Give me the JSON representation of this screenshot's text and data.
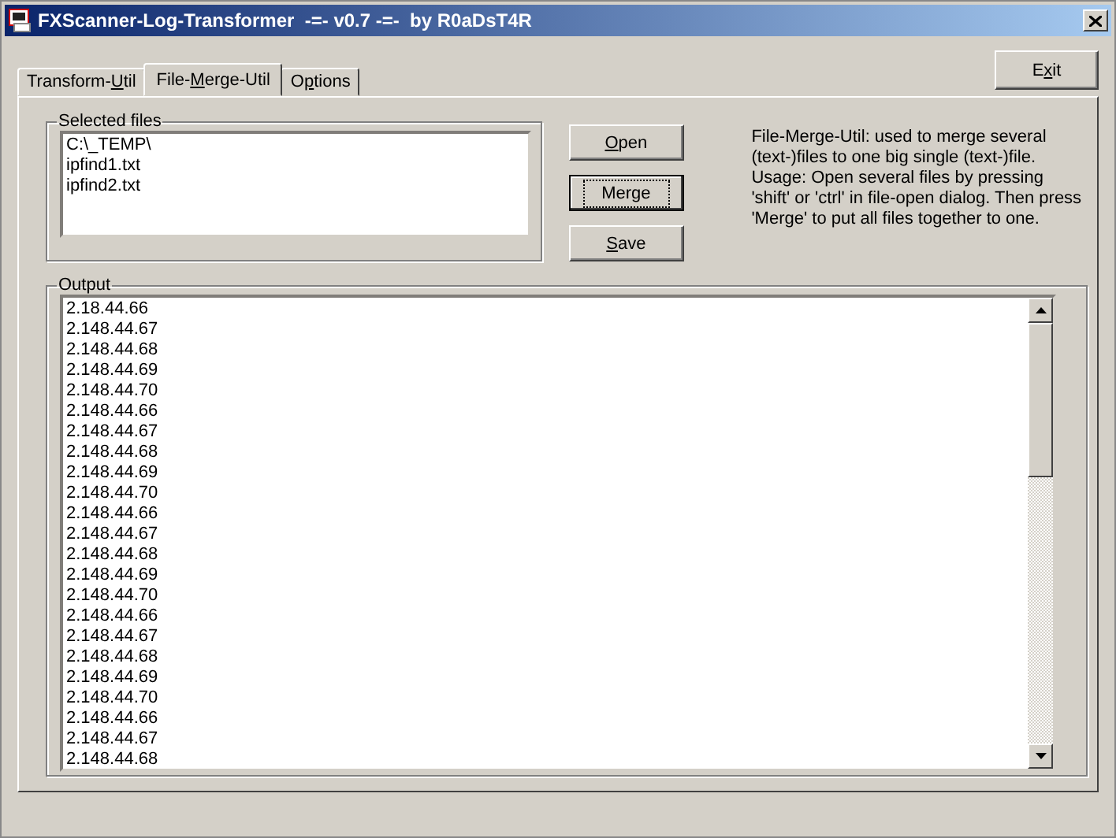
{
  "window": {
    "title": "FXScanner-Log-Transformer  -=- v0.7 -=-  by R0aDsT4R"
  },
  "tabs": [
    {
      "label": [
        "Transform-",
        "U",
        "til"
      ],
      "selected": false
    },
    {
      "label": [
        "File-",
        "M",
        "erge-Util"
      ],
      "selected": true
    },
    {
      "label": [
        "O",
        "p",
        "tions"
      ],
      "selected": false
    }
  ],
  "exit_button": {
    "label": [
      "E",
      "x",
      "it"
    ]
  },
  "selected_files": {
    "title": "Selected files",
    "items": [
      "C:\\_TEMP\\",
      "ipfind1.txt",
      "ipfind2.txt"
    ]
  },
  "buttons": [
    {
      "label": {
        "key": "O",
        "post": "pen"
      },
      "focused": false
    },
    {
      "label": {
        "pre": "Merge"
      },
      "focused": true
    },
    {
      "label": {
        "key": "S",
        "post": "ave"
      },
      "focused": false
    }
  ],
  "description": "File-Merge-Util: used to merge several (text-)files to one big single (text-)file. Usage: Open several files by pressing 'shift' or 'ctrl' in file-open dialog. Then press 'Merge' to put all files together to one.",
  "output": {
    "title": "Output",
    "lines": [
      "2.18.44.66",
      "2.148.44.67",
      "2.148.44.68",
      "2.148.44.69",
      "2.148.44.70",
      "2.148.44.66",
      "2.148.44.67",
      "2.148.44.68",
      "2.148.44.69",
      "2.148.44.70",
      "2.148.44.66",
      "2.148.44.67",
      "2.148.44.68",
      "2.148.44.69",
      "2.148.44.70",
      "2.148.44.66",
      "2.148.44.67",
      "2.148.44.68",
      "2.148.44.69",
      "2.148.44.70",
      "2.148.44.66",
      "2.148.44.67",
      "2.148.44.68"
    ]
  }
}
